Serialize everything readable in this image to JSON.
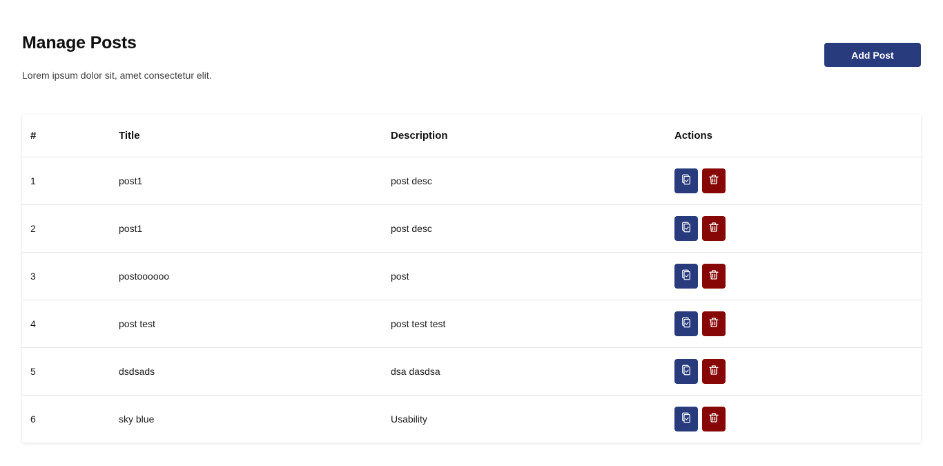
{
  "header": {
    "title": "Manage Posts",
    "subtitle": "Lorem ipsum dolor sit, amet consectetur elit.",
    "add_button_label": "Add Post"
  },
  "table": {
    "columns": [
      "#",
      "Title",
      "Description",
      "Actions"
    ],
    "rows": [
      {
        "num": "1",
        "title": "post1",
        "description": "post desc"
      },
      {
        "num": "2",
        "title": "post1",
        "description": "post desc"
      },
      {
        "num": "3",
        "title": "postoooooo",
        "description": "post"
      },
      {
        "num": "4",
        "title": "post test",
        "description": "post test test"
      },
      {
        "num": "5",
        "title": "dsdsads",
        "description": "dsa dasdsa"
      },
      {
        "num": "6",
        "title": "sky blue",
        "description": "Usability"
      }
    ],
    "row_actions": [
      {
        "icon": "clipboard-check-icon",
        "color": "#283b7d"
      },
      {
        "icon": "trash-icon",
        "color": "#870606"
      }
    ]
  },
  "colors": {
    "primary": "#283b7d",
    "danger": "#870606"
  }
}
